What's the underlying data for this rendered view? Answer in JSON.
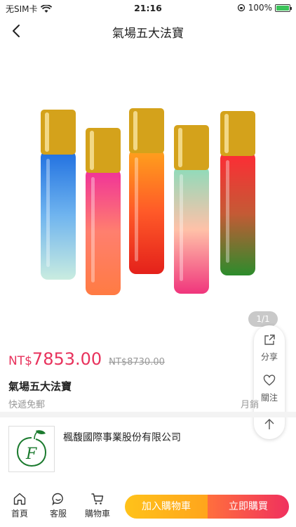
{
  "status_bar": {
    "carrier": "无SIM卡",
    "time": "21:16",
    "battery_percent": "100%",
    "battery_level": 1.0,
    "wifi_icon": "wifi-icon"
  },
  "nav": {
    "title": "氣場五大法寶",
    "back_icon": "chevron-left-icon"
  },
  "gallery": {
    "counter": "1/1",
    "bottle_colors": [
      [
        "#1f6fe0",
        "#6fb4ef",
        "#c9ece0"
      ],
      [
        "#f0309a",
        "#ff7f6e",
        "#ff7b43"
      ],
      [
        "#ffa21c",
        "#ff5a28",
        "#e4211b"
      ],
      [
        "#8bdcbb",
        "#ffc1a8",
        "#f0357c"
      ],
      [
        "#ff2b35",
        "#c45a35",
        "#2c8c2c"
      ]
    ],
    "cap_color": "#d4a21b"
  },
  "float_panel": {
    "share_label": "分享",
    "follow_label": "關注"
  },
  "product": {
    "currency": "NT$",
    "price": "7853.00",
    "original_price": "NT$8730.00",
    "name": "氣場五大法寶",
    "shipping": "快遞免郵",
    "monthly_sales": "月銷"
  },
  "shop": {
    "name": "楓馥國際事業股份有限公司"
  },
  "bottom_bar": {
    "home_label": "首頁",
    "service_label": "客服",
    "cart_label": "購物車",
    "add_to_cart_label": "加入購物車",
    "buy_now_label": "立即購買"
  },
  "colors": {
    "price": "#e8325c",
    "add_to_cart": "#ffb81b",
    "buy_now": "#f0305e"
  }
}
